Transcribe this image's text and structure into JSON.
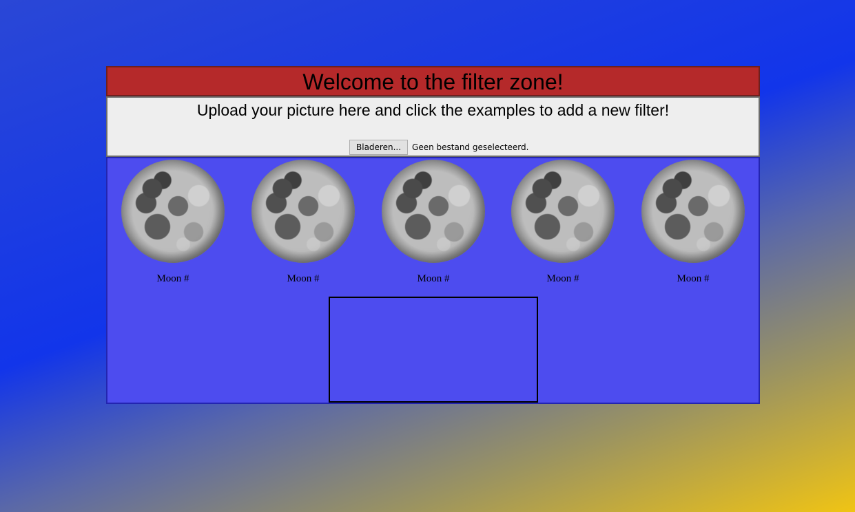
{
  "header": {
    "title": "Welcome to the filter zone!"
  },
  "upload": {
    "instructions": "Upload your picture here and click the examples to add a new filter!",
    "browse_label": "Bladeren...",
    "file_status": "Geen bestand geselecteerd."
  },
  "gallery": {
    "items": [
      {
        "caption": "Moon #",
        "image": "moon-image"
      },
      {
        "caption": "Moon #",
        "image": "moon-image"
      },
      {
        "caption": "Moon #",
        "image": "moon-image"
      },
      {
        "caption": "Moon #",
        "image": "moon-image"
      },
      {
        "caption": "Moon #",
        "image": "moon-image"
      }
    ]
  },
  "colors": {
    "header_bg": "#b5292a",
    "upload_bg": "#eeeeee",
    "gallery_bg": "#4d4cef"
  }
}
